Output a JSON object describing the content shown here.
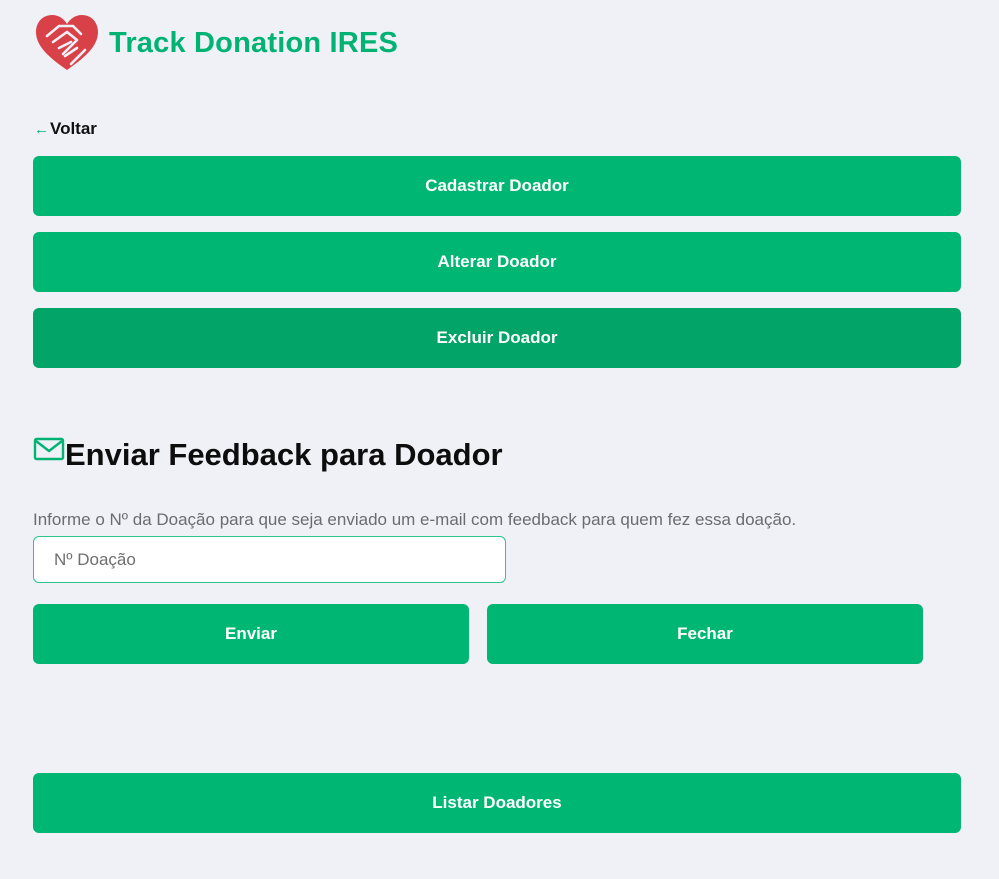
{
  "header": {
    "brand": "Track Donation IRES",
    "logo_icon": "heart-handshake-icon"
  },
  "nav": {
    "back_label": "Voltar",
    "back_icon": "arrow-left-icon"
  },
  "actions": {
    "register": "Cadastrar Doador",
    "edit": "Alterar Doador",
    "delete": "Excluir Doador"
  },
  "feedback": {
    "icon": "mail-icon",
    "title": "Enviar Feedback para Doador",
    "help_text": "Informe o Nº da Doação para que seja enviado um e-mail com feedback para quem fez essa doação.",
    "input_placeholder": "Nº Doação",
    "input_value": "",
    "send_label": "Enviar",
    "close_label": "Fechar"
  },
  "list_button": "Listar Doadores",
  "colors": {
    "primary": "#00b673",
    "primary_active": "#02a467",
    "logo_red": "#d94148",
    "background": "#f0f0f7"
  }
}
